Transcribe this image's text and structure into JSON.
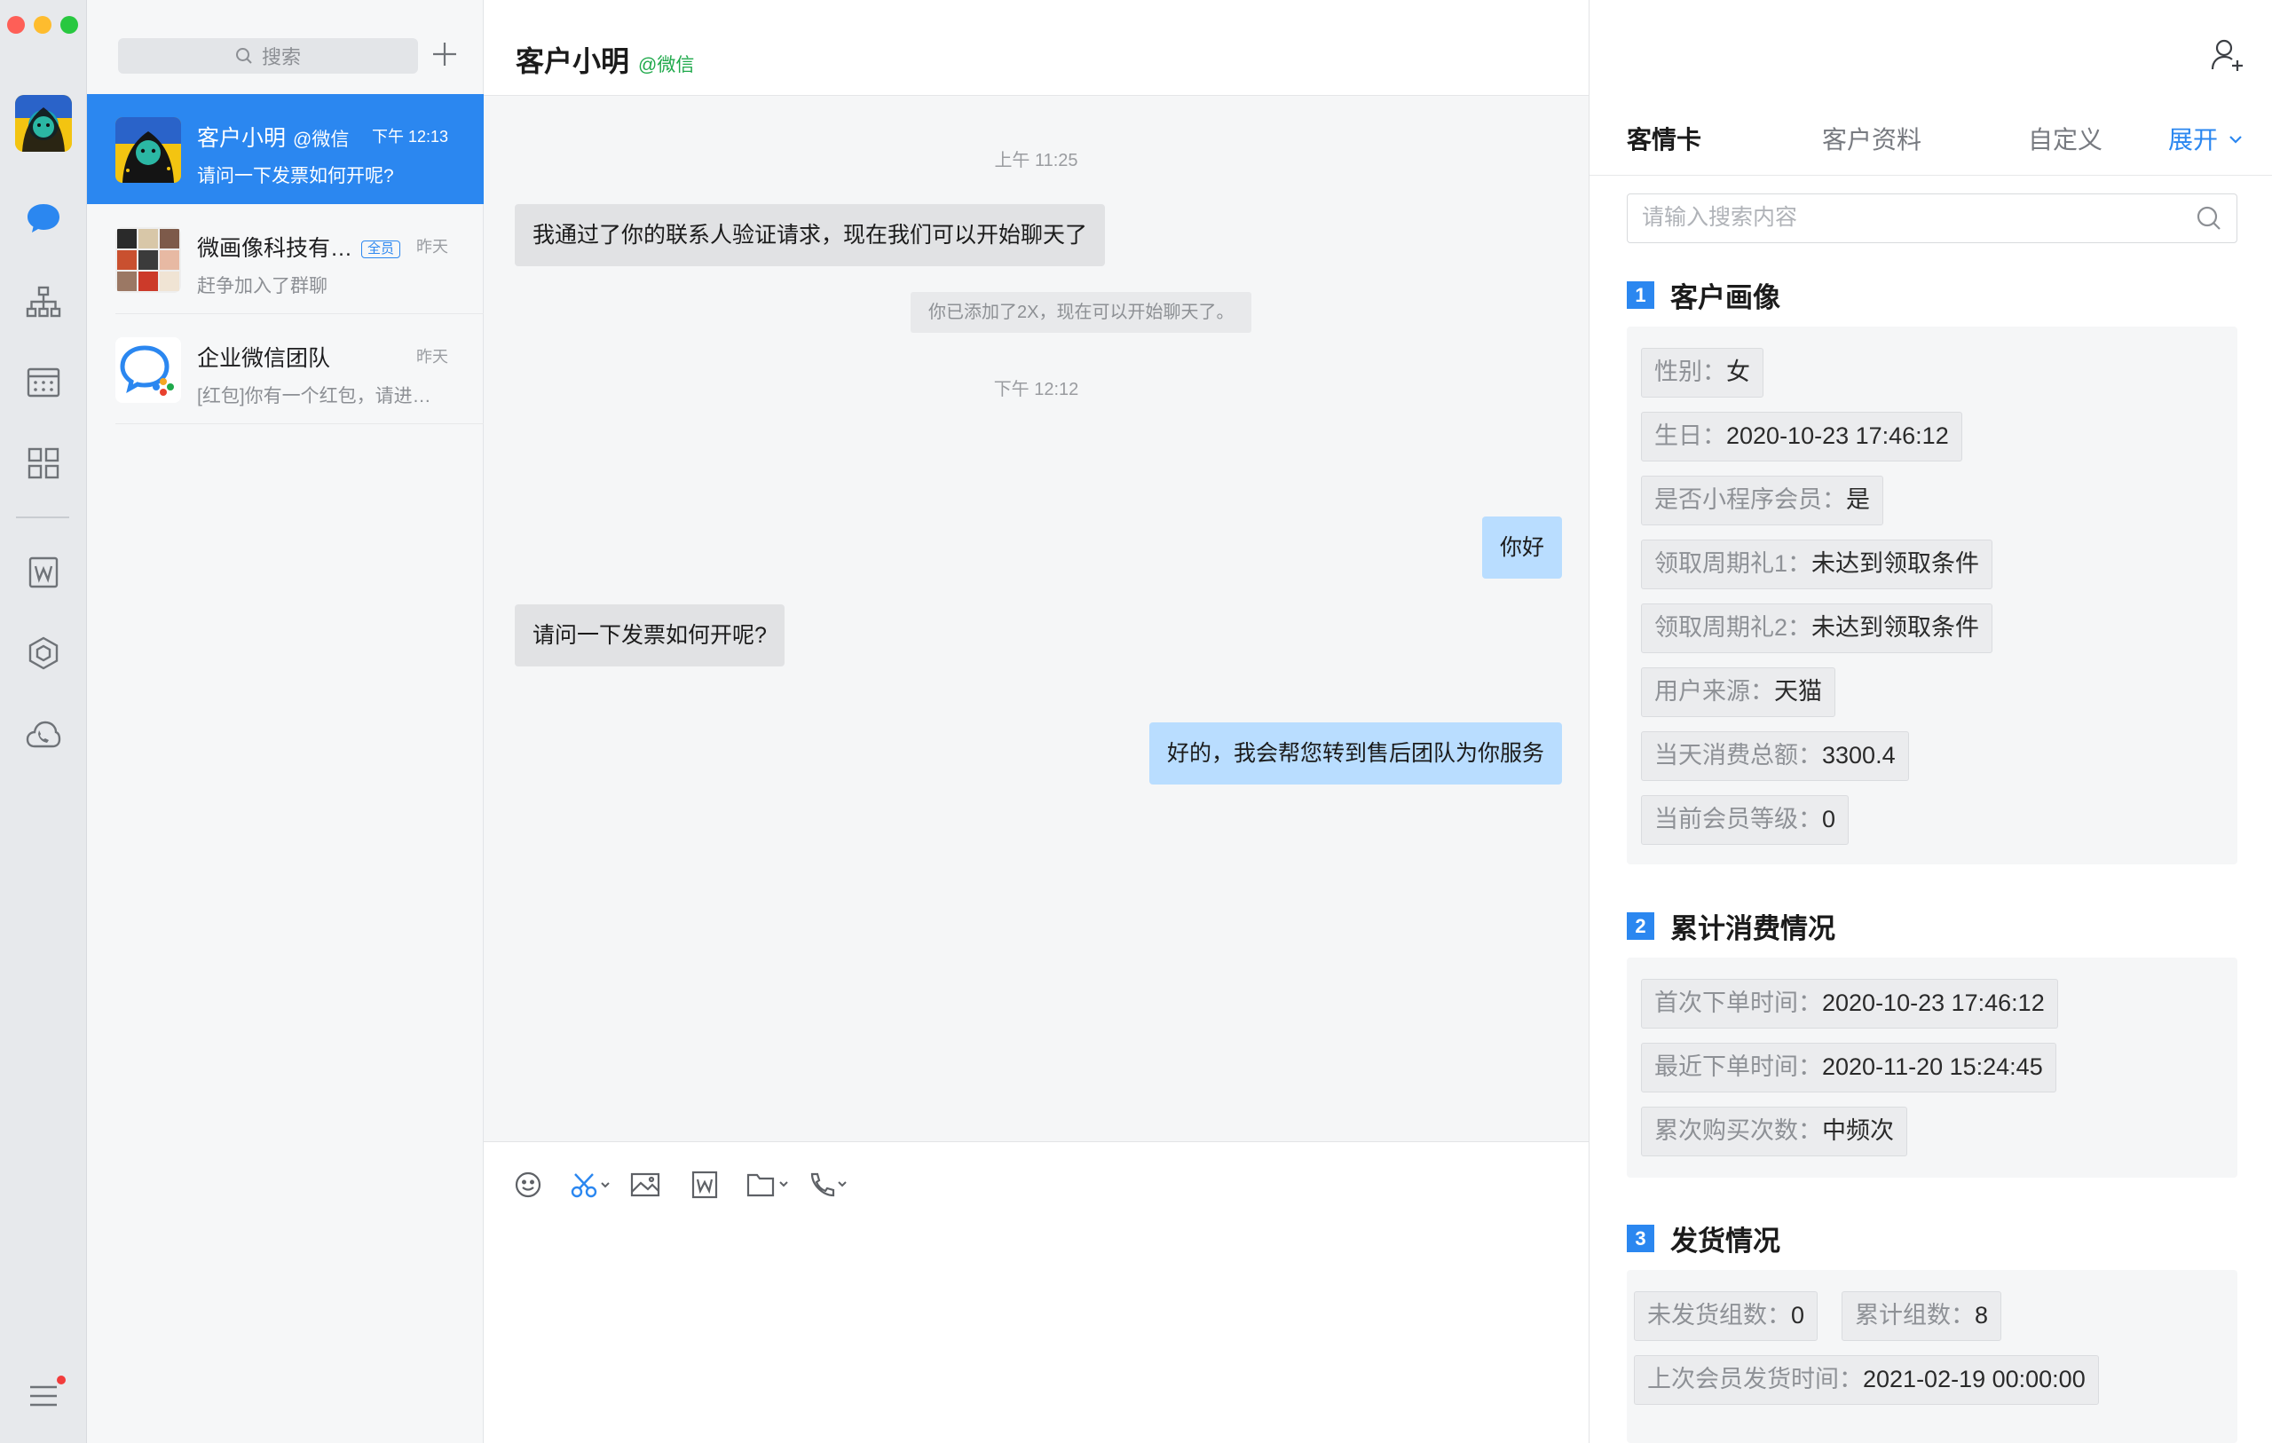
{
  "search": {
    "placeholder": "搜索"
  },
  "conversations": [
    {
      "name": "客户小明",
      "suffix": "@微信",
      "time": "下午 12:13",
      "preview": "请问一下发票如何开呢?",
      "active": true
    },
    {
      "name": "微画像科技有…",
      "badge": "全员",
      "time": "昨天",
      "preview": "赶争加入了群聊"
    },
    {
      "name": "企业微信团队",
      "time": "昨天",
      "preview": "[红包]你有一个红包，请进…"
    }
  ],
  "chat": {
    "title": "客户小明",
    "title_suffix": "@微信",
    "messages": [
      {
        "kind": "timestamp",
        "text": "上午 11:25"
      },
      {
        "kind": "incoming",
        "text": "我通过了你的联系人验证请求，现在我们可以开始聊天了"
      },
      {
        "kind": "system",
        "text": "你已添加了2X，现在可以开始聊天了。"
      },
      {
        "kind": "timestamp",
        "text": "下午 12:12"
      },
      {
        "kind": "outgoing",
        "text": "你好"
      },
      {
        "kind": "incoming",
        "text": "请问一下发票如何开呢?"
      },
      {
        "kind": "outgoing",
        "text": "好的，我会帮您转到售后团队为你服务"
      }
    ]
  },
  "panel": {
    "tabs": [
      "客情卡",
      "客户资料",
      "自定义"
    ],
    "expand_label": "展开",
    "search_placeholder": "请输入搜索内容",
    "sections": [
      {
        "num": "1",
        "title": "客户画像",
        "items": [
          {
            "k": "性别：",
            "v": "女"
          },
          {
            "k": "生日：",
            "v": "2020-10-23 17:46:12"
          },
          {
            "k": "是否小程序会员：",
            "v": "是"
          },
          {
            "k": "领取周期礼1：",
            "v": "未达到领取条件"
          },
          {
            "k": "领取周期礼2：",
            "v": "未达到领取条件"
          },
          {
            "k": "用户来源：",
            "v": "天猫"
          },
          {
            "k": "当天消费总额：",
            "v": "3300.4"
          },
          {
            "k": "当前会员等级：",
            "v": "0"
          }
        ]
      },
      {
        "num": "2",
        "title": "累计消费情况",
        "items": [
          {
            "k": "首次下单时间：",
            "v": "2020-10-23 17:46:12"
          },
          {
            "k": "最近下单时间：",
            "v": "2020-11-20 15:24:45"
          },
          {
            "k": "累次购买次数：",
            "v": "中频次"
          }
        ]
      },
      {
        "num": "3",
        "title": "发货情况",
        "items": [
          {
            "k": "未发货组数：",
            "v": "0"
          },
          {
            "k": "累计组数：",
            "v": "8"
          },
          {
            "k": "上次会员发货时间：",
            "v": "2021-02-19 00:00:00"
          }
        ]
      }
    ]
  },
  "colors": {
    "accent": "#2b87f0",
    "wechat_green": "#1fa94b",
    "outgoing_bubble": "#b9ddff",
    "incoming_bubble": "#e1e2e4"
  },
  "icons": {
    "rail": [
      "chat-icon",
      "org-chart-icon",
      "calendar-icon",
      "apps-grid-icon",
      "doc-w-icon",
      "hexagon-icon",
      "cloud-phone-icon",
      "menu-icon"
    ],
    "toolbar": [
      "emoji-icon",
      "screenshot-scissors-icon",
      "image-icon",
      "doc-w-icon",
      "folder-icon",
      "phone-icon"
    ]
  }
}
